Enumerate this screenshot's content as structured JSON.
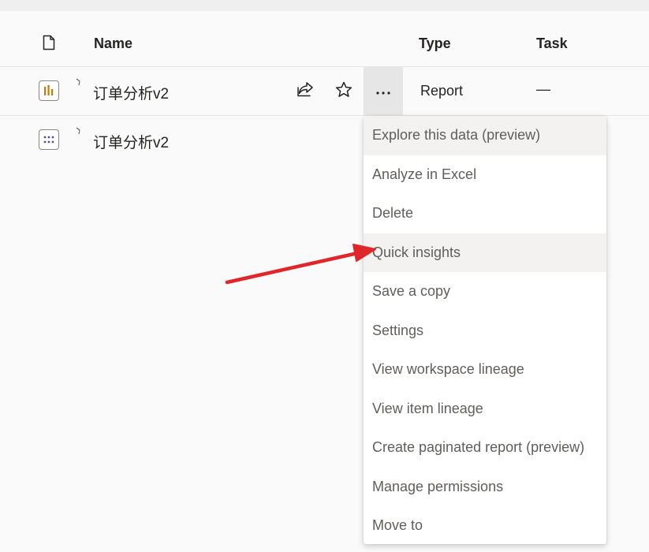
{
  "header": {
    "name": "Name",
    "type": "Type",
    "task": "Task"
  },
  "rows": [
    {
      "name": "订单分析v2",
      "type": "Report",
      "task": "—",
      "icon": "report-icon"
    },
    {
      "name": "订单分析v2",
      "icon": "dataset-icon"
    }
  ],
  "menu": {
    "items": [
      "Explore this data (preview)",
      "Analyze in Excel",
      "Delete",
      "Quick insights",
      "Save a copy",
      "Settings",
      "View workspace lineage",
      "View item lineage",
      "Create paginated report (preview)",
      "Manage permissions",
      "Move to"
    ]
  },
  "colors": {
    "accent_report": "#c07c0a",
    "accent_dataset": "#5c4b9e",
    "arrow": "#e0262b"
  }
}
